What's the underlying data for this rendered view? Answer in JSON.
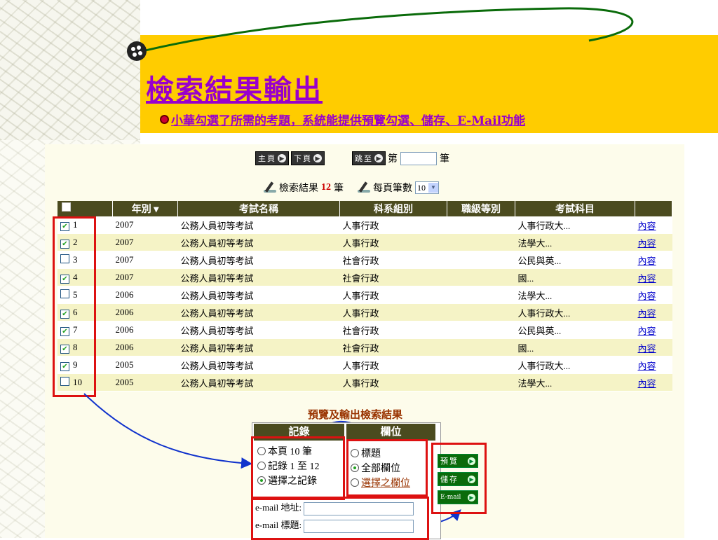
{
  "slide": {
    "title": "檢索結果輸出",
    "bullet": "小華勾選了所需的考題，系統能提供預覽勾選、儲存、E-Mail功能"
  },
  "nav": {
    "home": "主頁",
    "next": "下頁",
    "jump": "跳至",
    "page_prefix": "第",
    "page_suffix": "筆"
  },
  "results_info": {
    "label": "檢索結果",
    "count": "12",
    "unit": "筆",
    "per_page_label": "每頁筆數",
    "per_page_value": "10"
  },
  "table": {
    "headers": [
      "",
      "年別 ▾",
      "考試名稱",
      "科系組別",
      "職級等別",
      "考試科目",
      ""
    ],
    "rows": [
      {
        "checked": true,
        "no": "1",
        "year": "2007",
        "exam": "公務人員初等考試",
        "dept": "人事行政",
        "grade": "",
        "subject": "人事行政大...",
        "link": "內容"
      },
      {
        "checked": true,
        "no": "2",
        "year": "2007",
        "exam": "公務人員初等考試",
        "dept": "人事行政",
        "grade": "",
        "subject": "法學大...",
        "link": "內容"
      },
      {
        "checked": false,
        "no": "3",
        "year": "2007",
        "exam": "公務人員初等考試",
        "dept": "社會行政",
        "grade": "",
        "subject": "公民與英...",
        "link": "內容"
      },
      {
        "checked": true,
        "no": "4",
        "year": "2007",
        "exam": "公務人員初等考試",
        "dept": "社會行政",
        "grade": "",
        "subject": "國...",
        "link": "內容"
      },
      {
        "checked": false,
        "no": "5",
        "year": "2006",
        "exam": "公務人員初等考試",
        "dept": "人事行政",
        "grade": "",
        "subject": "法學大...",
        "link": "內容"
      },
      {
        "checked": true,
        "no": "6",
        "year": "2006",
        "exam": "公務人員初等考試",
        "dept": "人事行政",
        "grade": "",
        "subject": "人事行政大...",
        "link": "內容"
      },
      {
        "checked": true,
        "no": "7",
        "year": "2006",
        "exam": "公務人員初等考試",
        "dept": "社會行政",
        "grade": "",
        "subject": "公民與英...",
        "link": "內容"
      },
      {
        "checked": true,
        "no": "8",
        "year": "2006",
        "exam": "公務人員初等考試",
        "dept": "社會行政",
        "grade": "",
        "subject": "國...",
        "link": "內容"
      },
      {
        "checked": true,
        "no": "9",
        "year": "2005",
        "exam": "公務人員初等考試",
        "dept": "人事行政",
        "grade": "",
        "subject": "人事行政大...",
        "link": "內容"
      },
      {
        "checked": false,
        "no": "10",
        "year": "2005",
        "exam": "公務人員初等考試",
        "dept": "人事行政",
        "grade": "",
        "subject": "法學大...",
        "link": "內容"
      }
    ]
  },
  "output": {
    "title": "預覽及輸出檢索結果",
    "records_header": "記錄",
    "fields_header": "欄位",
    "records_options": [
      {
        "label": "本頁 10 筆",
        "selected": false
      },
      {
        "label": "記錄 1 至 12",
        "selected": false
      },
      {
        "label": "選擇之記錄",
        "selected": true
      }
    ],
    "fields_options": [
      {
        "label": "標題",
        "selected": false
      },
      {
        "label": "全部欄位",
        "selected": true
      },
      {
        "label": "選擇之欄位",
        "selected": false
      }
    ],
    "email_address_label": "e-mail 地址:",
    "email_subject_label": "e-mail 標題:",
    "buttons": {
      "preview": "預覽",
      "save": "儲存",
      "email": "E-mail"
    }
  },
  "colors": {
    "title": "#9900CC",
    "band": "#FFCC00",
    "table_header": "#4B4B1F",
    "highlight": "#DD1111",
    "arrow": "#1133CC"
  }
}
